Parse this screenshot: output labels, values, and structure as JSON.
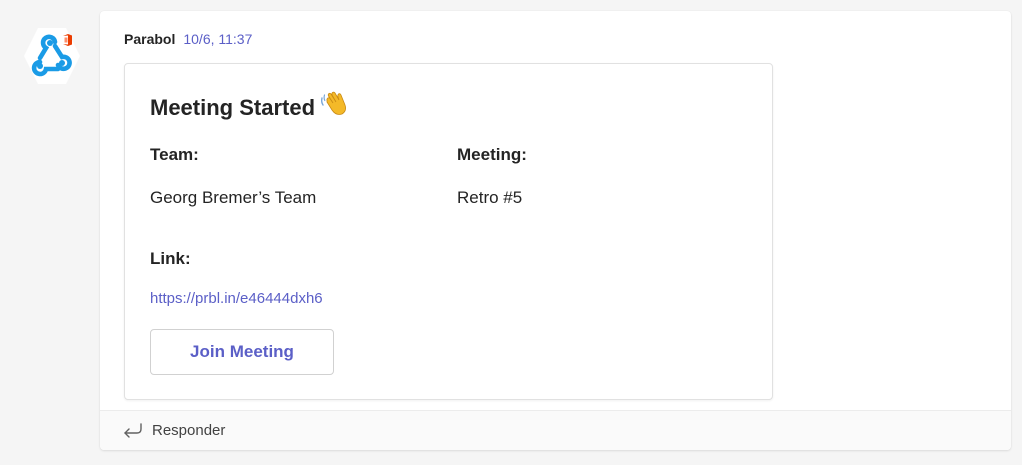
{
  "message": {
    "sender": "Parabol",
    "timestamp": "10/6, 11:37",
    "avatar_icon": "webhook-connector-icon",
    "avatar_badge_icon": "office-badge-icon"
  },
  "card": {
    "title": "Meeting Started",
    "title_emoji_icon": "waving-hand-icon",
    "team_label": "Team:",
    "team_value": "Georg Bremer’s Team",
    "meeting_label": "Meeting:",
    "meeting_value": "Retro #5",
    "link_label": "Link:",
    "link_text": "https://prbl.in/e46444dxh6",
    "join_button_label": "Join Meeting"
  },
  "reply": {
    "label": "Responder",
    "icon": "reply-arrow-icon"
  },
  "colors": {
    "accent": "#5b5fc7",
    "webhook_blue": "#1a9be6",
    "badge_orange": "#eb3c00"
  }
}
